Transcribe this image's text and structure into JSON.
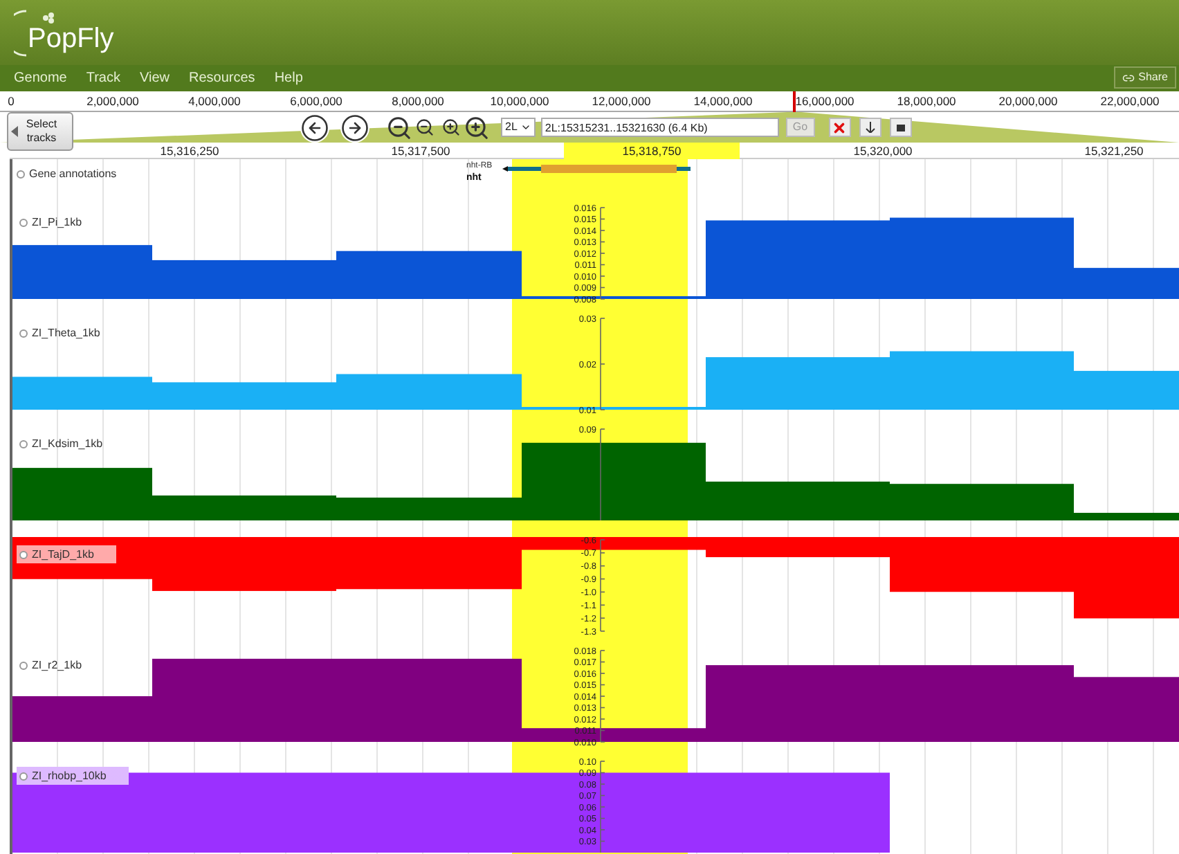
{
  "app": {
    "logo": "PopFly"
  },
  "menu": [
    "Genome",
    "Track",
    "View",
    "Resources",
    "Help"
  ],
  "share_button": {
    "label": "Share"
  },
  "overview_ruler": {
    "labels": [
      "0",
      "2,000,000",
      "4,000,000",
      "6,000,000",
      "8,000,000",
      "10,000,000",
      "12,000,000",
      "14,000,000",
      "16,000,000",
      "18,000,000",
      "20,000,000",
      "22,000,000"
    ]
  },
  "toolbar": {
    "select_tracks": "Select tracks",
    "chromosome": "2L",
    "location": "2L:15315231..15321630 (6.4 Kb)",
    "go": {
      "label": "Go",
      "disabled": true
    }
  },
  "detail_ruler": [
    {
      "label": "15,316,250",
      "selected": false
    },
    {
      "label": "15,317,500",
      "selected": false
    },
    {
      "label": "15,318,750",
      "selected": true
    },
    {
      "label": "15,320,000",
      "selected": false
    },
    {
      "label": "15,321,250",
      "selected": false
    }
  ],
  "gene_track": {
    "name": "Gene annotations",
    "transcript": "nht-RB",
    "gene": "nht"
  },
  "tracks": [
    {
      "name": "ZI_Pi_1kb",
      "highlighted": false,
      "color": "#0b55d6",
      "axis_labels": [
        "0.016",
        "0.015",
        "0.014",
        "0.013",
        "0.012",
        "0.011",
        "0.010",
        "0.009",
        "0.008"
      ]
    },
    {
      "name": "ZI_Theta_1kb",
      "highlighted": false,
      "color": "#1ab0f5",
      "axis_labels": [
        "0.03",
        "0.02",
        "0.01"
      ]
    },
    {
      "name": "ZI_Kdsim_1kb",
      "highlighted": false,
      "color": "#006400",
      "axis_labels": [
        "0.09"
      ]
    },
    {
      "name": "ZI_TajD_1kb",
      "highlighted": true,
      "color": "#ff0000",
      "axis_labels": [
        "-0.6",
        "-0.7",
        "-0.8",
        "-0.9",
        "-1.0",
        "-1.1",
        "-1.2",
        "-1.3"
      ]
    },
    {
      "name": "ZI_r2_1kb",
      "highlighted": false,
      "color": "#800080",
      "axis_labels": [
        "0.018",
        "0.017",
        "0.016",
        "0.015",
        "0.014",
        "0.013",
        "0.012",
        "0.011",
        "0.010"
      ]
    },
    {
      "name": "ZI_rhobp_10kb",
      "highlighted": true,
      "color": "#9b30ff",
      "axis_labels": [
        "0.10",
        "0.09",
        "0.08",
        "0.07",
        "0.06",
        "0.05",
        "0.04",
        "0.03"
      ]
    }
  ]
}
